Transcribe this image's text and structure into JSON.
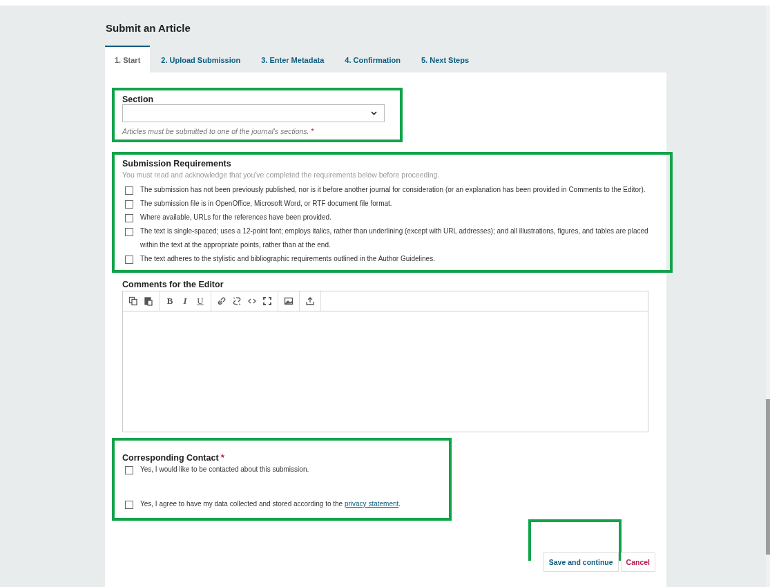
{
  "title": "Submit an Article",
  "tabs": [
    {
      "label": "1. Start",
      "selected": true
    },
    {
      "label": "2. Upload Submission",
      "selected": false
    },
    {
      "label": "3. Enter Metadata",
      "selected": false
    },
    {
      "label": "4. Confirmation",
      "selected": false
    },
    {
      "label": "5. Next Steps",
      "selected": false
    }
  ],
  "section": {
    "label": "Section",
    "description": "Articles must be submitted to one of the journal's sections.",
    "required_mark": "*"
  },
  "requirements": {
    "title": "Submission Requirements",
    "description": "You must read and acknowledge that you've completed the requirements below before proceeding.",
    "items": [
      {
        "text": "The submission has not been previously published, nor is it before another journal for consideration (or an explanation has been provided in Comments to the Editor).",
        "checked": false
      },
      {
        "text": "The submission file is in OpenOffice, Microsoft Word, or RTF document file format.",
        "checked": false
      },
      {
        "text": "Where available, URLs for the references have been provided.",
        "checked": false
      },
      {
        "text": "The text is single-spaced; uses a 12-point font; employs italics, rather than underlining (except with URL addresses); and all illustrations, figures, and tables are placed within the text at the appropriate points, rather than at the end.",
        "checked": false
      },
      {
        "text": "The text adheres to the stylistic and bibliographic requirements outlined in the Author Guidelines.",
        "checked": false
      }
    ]
  },
  "comments": {
    "label": "Comments for the Editor",
    "toolbar": [
      {
        "kind": "copy"
      },
      {
        "kind": "paste"
      },
      {
        "kind": "bold",
        "label": "B"
      },
      {
        "kind": "italic",
        "label": "I"
      },
      {
        "kind": "underline",
        "label": "U"
      },
      {
        "kind": "link"
      },
      {
        "kind": "unlink"
      },
      {
        "kind": "code"
      },
      {
        "kind": "fullscreen"
      },
      {
        "kind": "image"
      },
      {
        "kind": "upload"
      }
    ]
  },
  "contact": {
    "label": "Corresponding Contact",
    "required_mark": "*",
    "items": [
      {
        "text": "Yes, I would like to be contacted about this submission.",
        "checked": false
      },
      {
        "text": "Yes, I agree to have my data collected and stored according to the ",
        "link": "privacy statement",
        "after": ".",
        "checked": false
      }
    ]
  },
  "buttons": [
    {
      "label": "Save and continue",
      "kind": "primary"
    },
    {
      "label": "Cancel",
      "kind": "cancel"
    }
  ]
}
